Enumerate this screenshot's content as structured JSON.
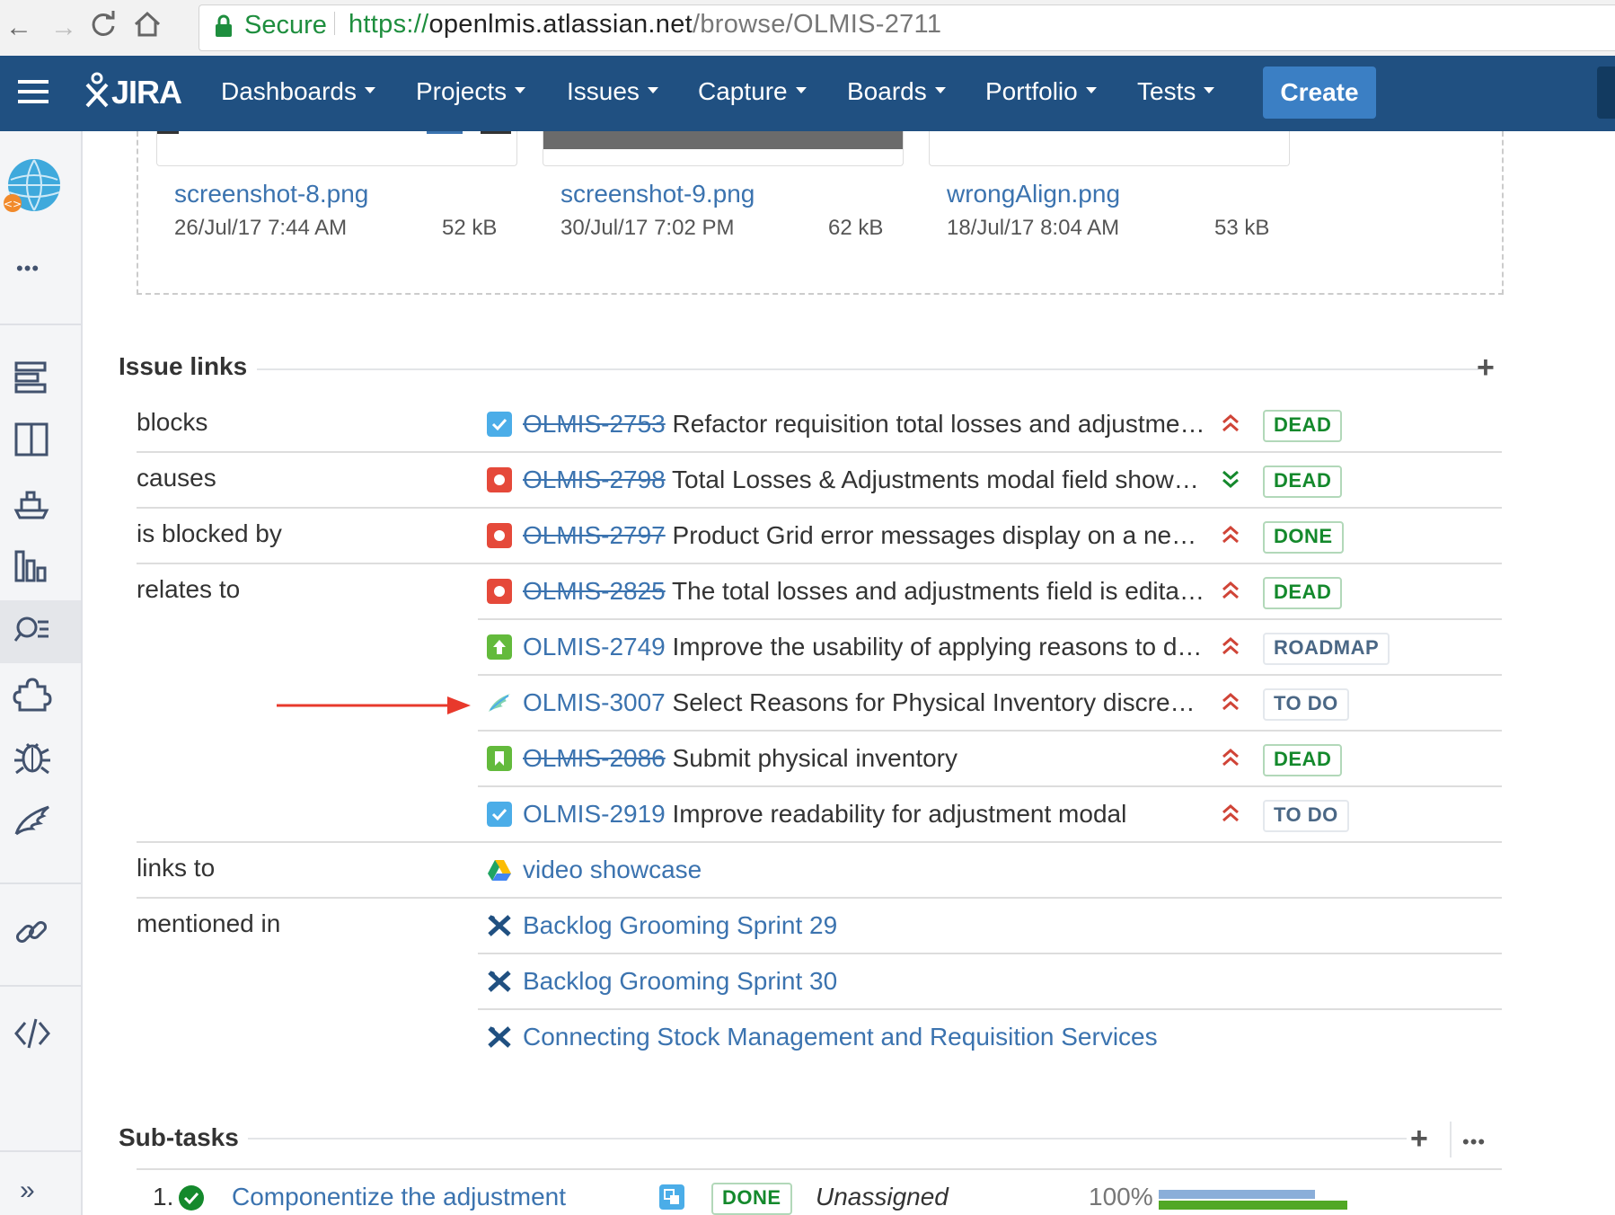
{
  "browser": {
    "secure_label": "Secure",
    "url_scheme": "https://",
    "url_host": "openlmis.atlassian.net",
    "url_path": "/browse/OLMIS-2711"
  },
  "nav": {
    "logo_text": "JIRA",
    "items": [
      "Dashboards",
      "Projects",
      "Issues",
      "Capture",
      "Boards",
      "Portfolio",
      "Tests"
    ],
    "create_label": "Create"
  },
  "sidebar": {
    "more_label": "•••",
    "collapse_label": "»"
  },
  "attachments": [
    {
      "name": "screenshot-8.png",
      "date": "26/Jul/17 7:44 AM",
      "size": "52 kB"
    },
    {
      "name": "screenshot-9.png",
      "date": "30/Jul/17 7:02 PM",
      "size": "62 kB"
    },
    {
      "name": "wrongAlign.png",
      "date": "18/Jul/17 8:04 AM",
      "size": "53 kB"
    }
  ],
  "issue_links": {
    "title": "Issue links",
    "add_label": "+",
    "rows": [
      {
        "relation": "blocks",
        "key": "OLMIS-2753",
        "summary": "Refactor requisition total losses and adjustme…",
        "status": "DEAD",
        "type": "task",
        "priority": "high"
      },
      {
        "relation": "causes",
        "key": "OLMIS-2798",
        "summary": "Total Losses & Adjustments modal field show…",
        "status": "DEAD",
        "type": "bug",
        "priority": "low"
      },
      {
        "relation": "is blocked by",
        "key": "OLMIS-2797",
        "summary": "Product Grid error messages display on a ne…",
        "status": "DONE",
        "type": "bug",
        "priority": "high"
      },
      {
        "relation": "relates to",
        "key": "OLMIS-2825",
        "summary": "The total losses and adjustments field is edita…",
        "status": "DEAD",
        "type": "bug",
        "priority": "high"
      },
      {
        "relation": "",
        "key": "OLMIS-2749",
        "summary": "Improve the usability of applying reasons to d…",
        "status": "ROADMAP",
        "type": "improvement",
        "priority": "high"
      },
      {
        "relation": "",
        "key": "OLMIS-3007",
        "summary": "Select Reasons for Physical Inventory discre…",
        "status": "TO DO",
        "type": "feature",
        "priority": "high"
      },
      {
        "relation": "",
        "key": "OLMIS-2086",
        "summary": "Submit physical inventory",
        "status": "DEAD",
        "type": "story",
        "priority": "high"
      },
      {
        "relation": "",
        "key": "OLMIS-2919",
        "summary": "Improve readability for adjustment modal",
        "status": "TO DO",
        "type": "task",
        "priority": "high"
      }
    ],
    "remote": [
      {
        "relation": "links to",
        "title": "video showcase",
        "icon": "google-drive-icon"
      },
      {
        "relation": "mentioned in",
        "title": "Backlog Grooming Sprint 29",
        "icon": "confluence-icon"
      },
      {
        "relation": "",
        "title": "Backlog Grooming Sprint 30",
        "icon": "confluence-icon"
      },
      {
        "relation": "",
        "title": "Connecting Stock Management and Requisition Services",
        "icon": "confluence-icon"
      }
    ]
  },
  "subtasks": {
    "title": "Sub-tasks",
    "add_label": "+",
    "more_label": "•••",
    "rows": [
      {
        "index": "1.",
        "summary": "Componentize the adjustment",
        "status": "DONE",
        "assignee": "Unassigned",
        "progress_label": "100%",
        "progress": 1.0
      }
    ]
  },
  "colors": {
    "nav_bg": "#205081",
    "create_bg": "#3b7fc4",
    "link_blue": "#3b73af",
    "priority_red": "#d04437",
    "priority_green": "#14892c",
    "status_green": "#14892c",
    "status_blue": "#4a6785",
    "annotation_arrow": "#e8392c"
  }
}
